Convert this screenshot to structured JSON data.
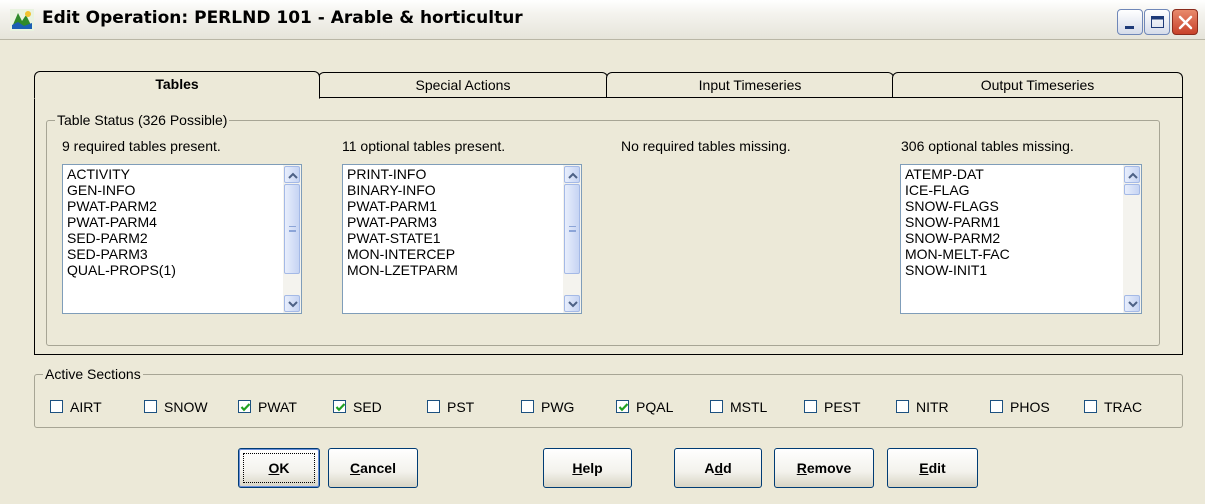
{
  "window": {
    "title": "Edit Operation:  PERLND 101 - Arable & horticultur",
    "icon": "app-icon",
    "controls": [
      "minimize-icon",
      "maximize-icon",
      "close-icon"
    ]
  },
  "tabs": [
    {
      "label": "Tables",
      "active": true
    },
    {
      "label": "Special Actions",
      "active": false
    },
    {
      "label": "Input Timeseries",
      "active": false
    },
    {
      "label": "Output Timeseries",
      "active": false
    }
  ],
  "table_status": {
    "legend": "Table Status (326 Possible)",
    "required_present": {
      "label": "9 required tables present.",
      "items": [
        "ACTIVITY",
        "GEN-INFO",
        "PWAT-PARM2",
        "PWAT-PARM4",
        "SED-PARM2",
        "SED-PARM3",
        "QUAL-PROPS(1)"
      ]
    },
    "optional_present": {
      "label": "11 optional tables present.",
      "items": [
        "PRINT-INFO",
        "BINARY-INFO",
        "PWAT-PARM1",
        "PWAT-PARM3",
        "PWAT-STATE1",
        "MON-INTERCEP",
        "MON-LZETPARM"
      ]
    },
    "required_missing": {
      "label": "No required tables missing."
    },
    "optional_missing": {
      "label": "306 optional tables missing.",
      "items": [
        "ATEMP-DAT",
        "ICE-FLAG",
        "SNOW-FLAGS",
        "SNOW-PARM1",
        "SNOW-PARM2",
        "MON-MELT-FAC",
        "SNOW-INIT1"
      ]
    }
  },
  "active_sections": {
    "legend": "Active Sections",
    "items": [
      {
        "label": "AIRT",
        "checked": false
      },
      {
        "label": "SNOW",
        "checked": false
      },
      {
        "label": "PWAT",
        "checked": true
      },
      {
        "label": "SED",
        "checked": true
      },
      {
        "label": "PST",
        "checked": false
      },
      {
        "label": "PWG",
        "checked": false
      },
      {
        "label": "PQAL",
        "checked": true
      },
      {
        "label": "MSTL",
        "checked": false
      },
      {
        "label": "PEST",
        "checked": false
      },
      {
        "label": "NITR",
        "checked": false
      },
      {
        "label": "PHOS",
        "checked": false
      },
      {
        "label": "TRAC",
        "checked": false
      }
    ]
  },
  "buttons": {
    "ok": {
      "mnemonic": "O",
      "rest": "K"
    },
    "cancel": {
      "mnemonic": "C",
      "rest": "ancel"
    },
    "help": {
      "mnemonic": "H",
      "rest": "elp"
    },
    "add": {
      "pre": "A",
      "mnemonic": "d",
      "rest": "d"
    },
    "remove": {
      "mnemonic": "R",
      "rest": "emove"
    },
    "edit": {
      "mnemonic": "E",
      "rest": "dit"
    }
  }
}
